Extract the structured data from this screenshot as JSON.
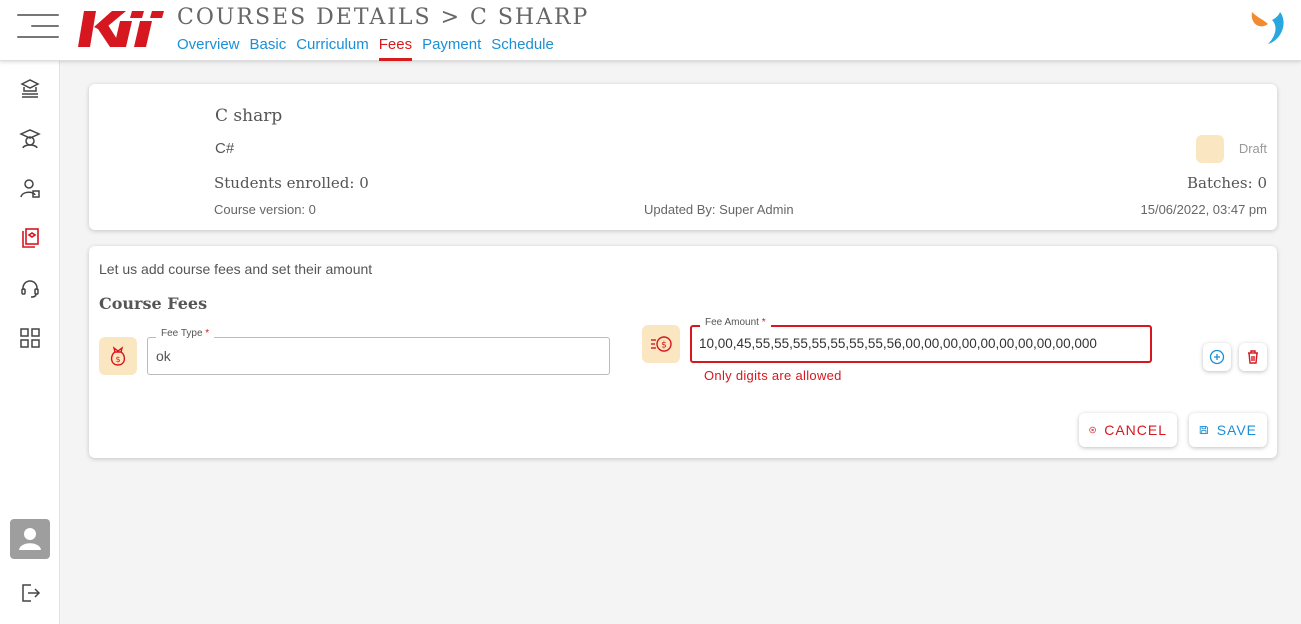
{
  "header": {
    "title": "COURSES DETAILS > C SHARP",
    "tabs": [
      {
        "label": "Overview",
        "active": false
      },
      {
        "label": "Basic",
        "active": false
      },
      {
        "label": "Curriculum",
        "active": false
      },
      {
        "label": "Fees",
        "active": true
      },
      {
        "label": "Payment",
        "active": false
      },
      {
        "label": "Schedule",
        "active": false
      }
    ]
  },
  "sidebar": {
    "icons": [
      "courses-stack-icon",
      "graduate-icon",
      "user-admin-icon",
      "course-book-icon",
      "headset-support-icon",
      "dashboard-grid-icon",
      "avatar-icon",
      "logout-icon"
    ],
    "active": "course-book-icon"
  },
  "course": {
    "name": "C sharp",
    "code": "C#",
    "status": "Draft",
    "students_enrolled": "Students enrolled: 0",
    "batches": "Batches: 0",
    "version": "Course version: 0",
    "updated_by": "Updated By: Super Admin",
    "updated_at": "15/06/2022, 03:47 pm"
  },
  "fees": {
    "intro": "Let us add course fees and set their amount",
    "section_title": "Course Fees",
    "fee_type_label": "Fee Type",
    "fee_type_value": "ok",
    "fee_amount_label": "Fee Amount",
    "fee_amount_value": "10,00,45,55,55,55,55,55,55,55,56,00,00,00,00,00,00,00,00,00,000",
    "error": "Only digits are allowed",
    "required_mark": "*"
  },
  "actions": {
    "cancel": "CANCEL",
    "save": "SAVE"
  },
  "colors": {
    "accent_red": "#d6171f",
    "link_blue": "#1a8fd6",
    "chip_bg": "#fbe6c2"
  }
}
